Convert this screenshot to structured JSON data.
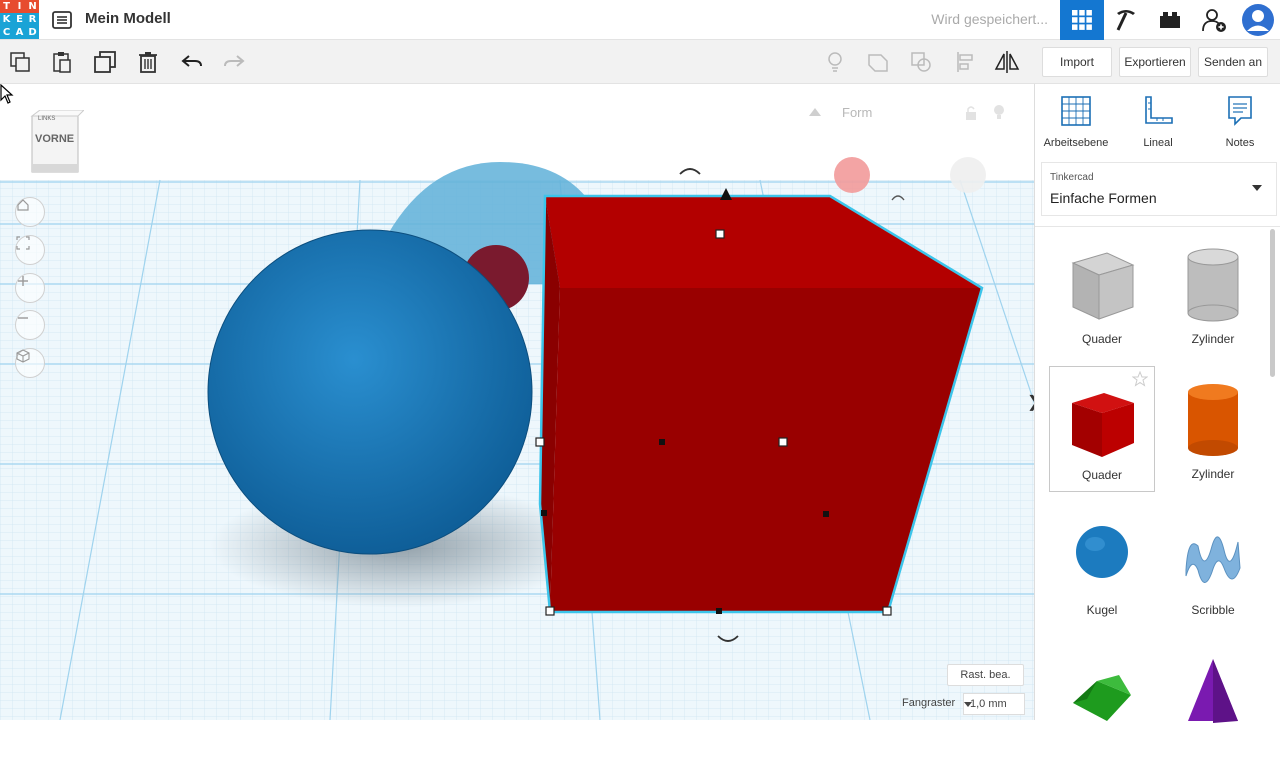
{
  "app": {
    "logo_letters": [
      "T",
      "I",
      "N",
      "K",
      "E",
      "R",
      "C",
      "A",
      "D"
    ],
    "logo_colors": [
      "#e74c2f",
      "#e74c2f",
      "#e74c2f",
      "#1aa3d6",
      "#1aa3d6",
      "#1aa3d6",
      "#1aa3d6",
      "#1aa3d6",
      "#1aa3d6"
    ],
    "project_title": "Mein Modell",
    "save_status": "Wird gespeichert...",
    "accent_color": "#1477d1"
  },
  "header_icons": [
    "grid-view-icon",
    "pickaxe-icon",
    "bricks-icon",
    "add-user-icon",
    "avatar-icon"
  ],
  "toolbar": {
    "tools": [
      "copy-icon",
      "paste-icon",
      "duplicate-icon",
      "delete-icon",
      "undo-icon",
      "redo-icon"
    ],
    "right_tools": [
      "light-icon",
      "group-icon",
      "ungroup-icon",
      "align-icon",
      "mirror-icon"
    ],
    "import_label": "Import",
    "export_label": "Exportieren",
    "send_label": "Senden an"
  },
  "viewport": {
    "view_cube_label": "VORNE",
    "view_cube_small": "LINKS",
    "shape_panel_label": "Form",
    "rast_label": "Rast. bea.",
    "grid_label": "Fangraster",
    "grid_value": "1,0 mm",
    "nav_controls": [
      "home-icon",
      "fit-icon",
      "zoom-in-icon",
      "zoom-out-icon",
      "ortho-icon"
    ]
  },
  "sidebar": {
    "tools": [
      {
        "label": "Arbeitsebene",
        "icon": "workplane-icon"
      },
      {
        "label": "Lineal",
        "icon": "ruler-icon"
      },
      {
        "label": "Notes",
        "icon": "notes-icon"
      }
    ],
    "library_small": "Tinkercad",
    "library_big": "Einfache Formen",
    "shapes": [
      {
        "label": "Quader",
        "color": "#a9a9a9",
        "kind": "box-hole"
      },
      {
        "label": "Zylinder",
        "color": "#b0b0b0",
        "kind": "cyl-hole"
      },
      {
        "label": "Quader",
        "color": "#c00000",
        "kind": "box"
      },
      {
        "label": "Zylinder",
        "color": "#e05a00",
        "kind": "cyl"
      },
      {
        "label": "Kugel",
        "color": "#1c7bbf",
        "kind": "sphere"
      },
      {
        "label": "Scribble",
        "color": "#6fa8dc",
        "kind": "scribble"
      },
      {
        "label": "",
        "color": "#1aa31a",
        "kind": "roof"
      },
      {
        "label": "",
        "color": "#7a1ab0",
        "kind": "cone"
      }
    ]
  }
}
